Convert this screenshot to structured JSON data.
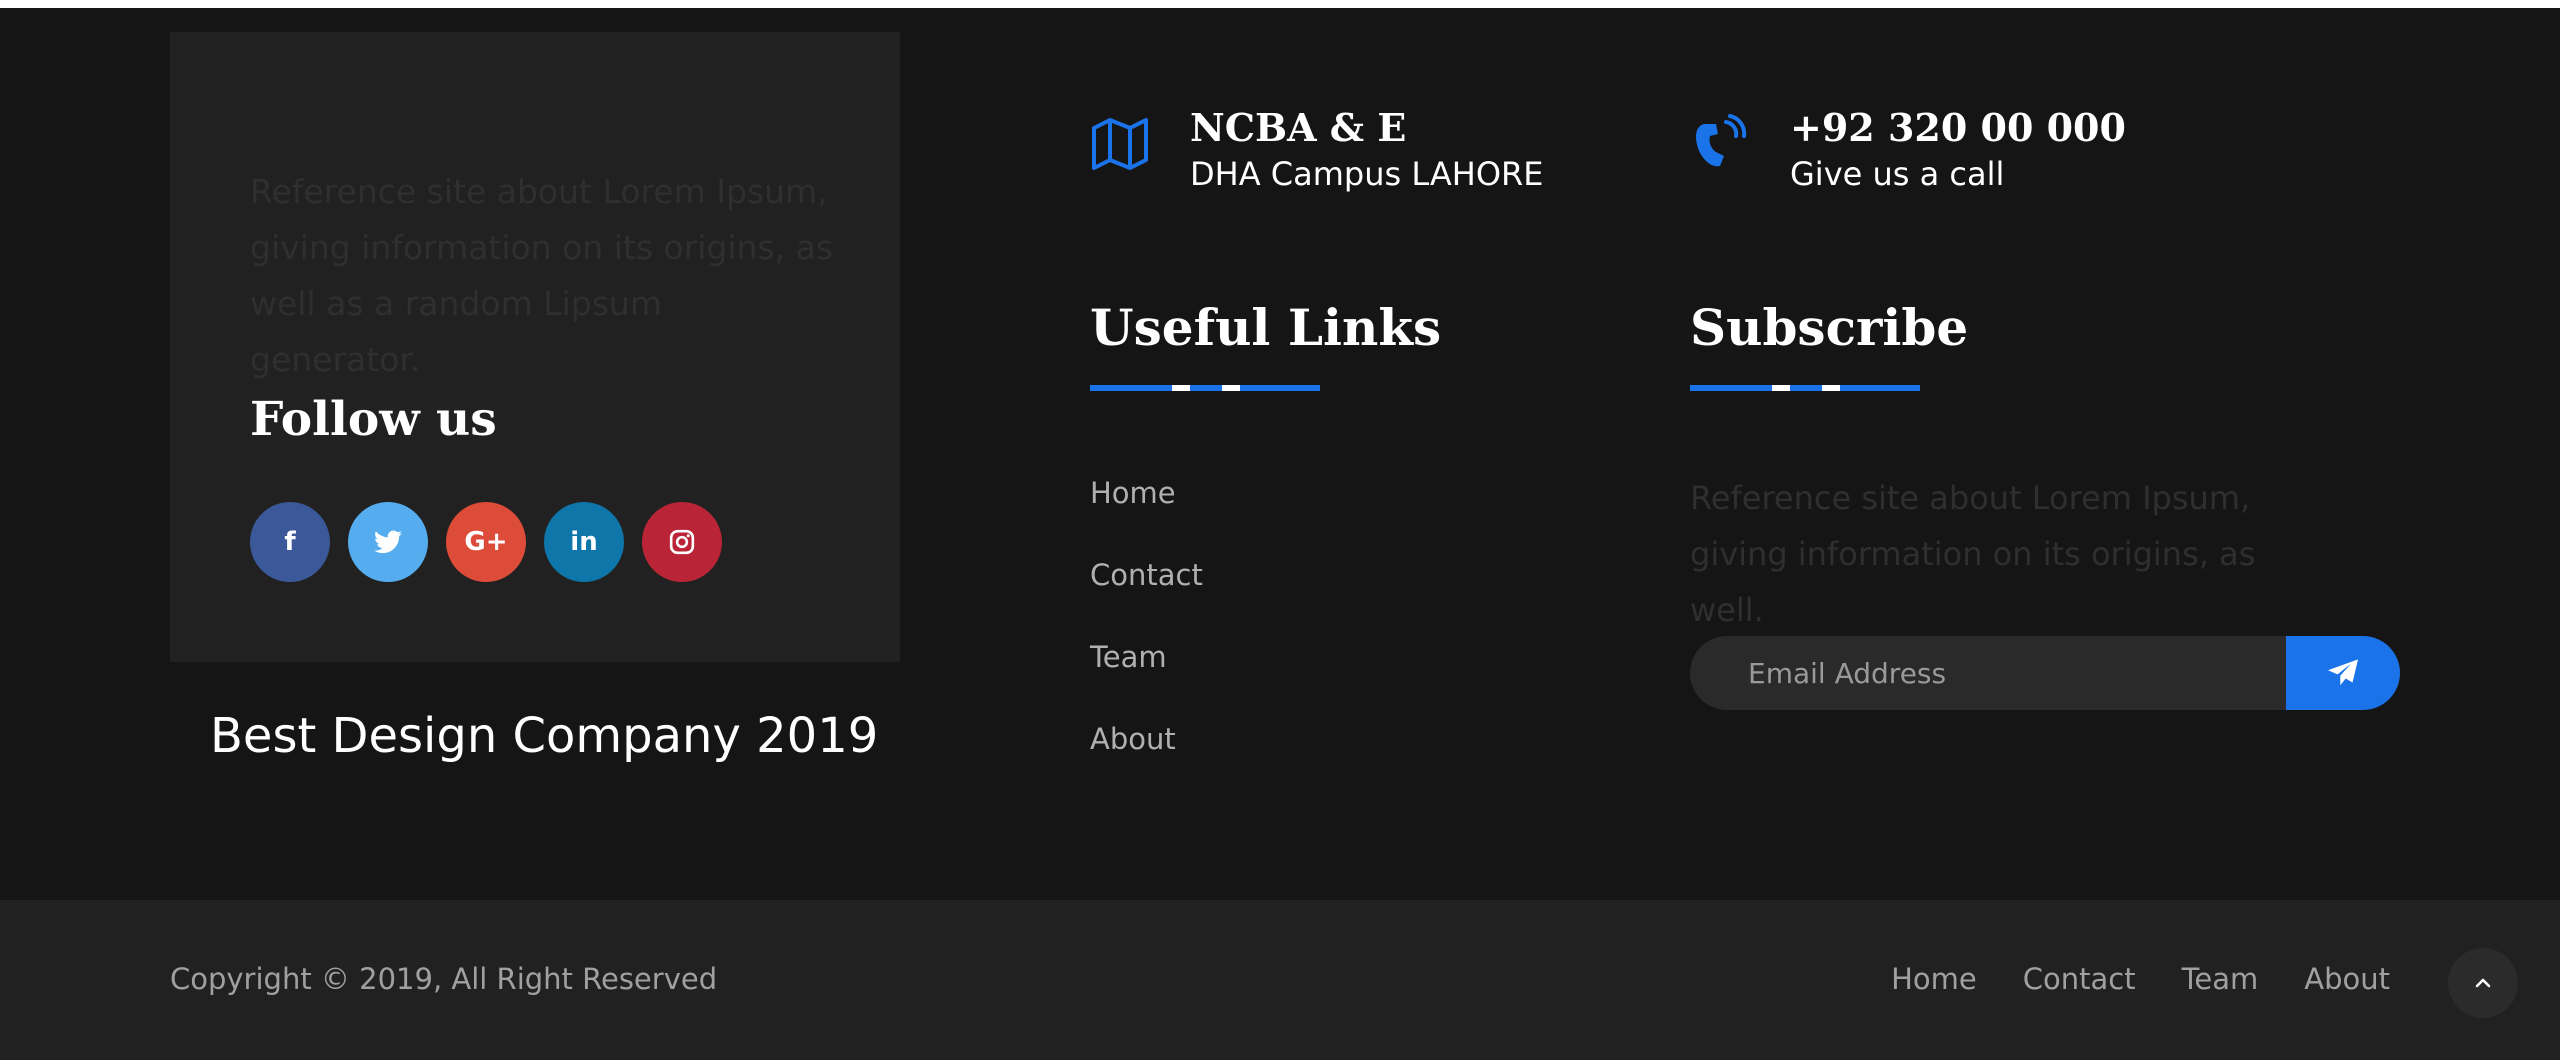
{
  "about": {
    "text": "Reference site about Lorem Ipsum, giving information on its origins, as well as a random Lipsum generator.",
    "follow_title": "Follow us",
    "socials": [
      {
        "name": "facebook",
        "glyph": "f",
        "color": "#3b5998"
      },
      {
        "name": "twitter",
        "glyph": "t",
        "color": "#55acee"
      },
      {
        "name": "google-plus",
        "glyph": "G+",
        "color": "#dd4b39"
      },
      {
        "name": "linkedin",
        "glyph": "in",
        "color": "#0e76a8"
      },
      {
        "name": "instagram",
        "glyph": "◎",
        "color": "#b92536"
      }
    ]
  },
  "award": "Best Design Company 2019",
  "contact": {
    "address_title": "NCBA & E",
    "address_sub": "DHA Campus LAHORE",
    "phone_title": "+92 320 00 000",
    "phone_sub": "Give us a call"
  },
  "useful_links": {
    "title": "Useful Links",
    "items": [
      "Home",
      "Contact",
      "Team",
      "About"
    ]
  },
  "subscribe": {
    "title": "Subscribe",
    "text": "Reference site about Lorem Ipsum, giving information on its origins, as well.",
    "email_placeholder": "Email Address"
  },
  "bottom": {
    "copyright": "Copyright © 2019, All Right Reserved",
    "nav": [
      "Home",
      "Contact",
      "Team",
      "About"
    ]
  },
  "colors": {
    "accent": "#1a73e8",
    "background": "#151515",
    "panel": "#212121"
  },
  "icons": {
    "address": "map-icon",
    "phone": "phone-icon",
    "send": "paper-plane-icon",
    "top": "chevron-up-icon"
  }
}
